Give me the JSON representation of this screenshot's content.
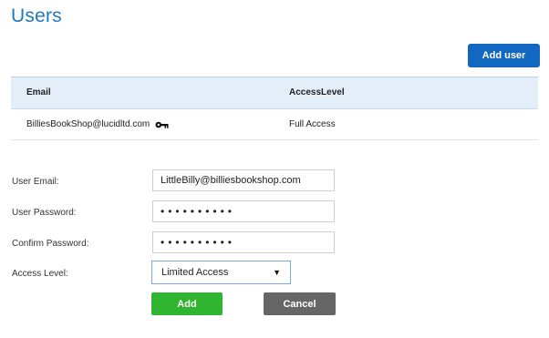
{
  "page": {
    "title": "Users",
    "add_user_label": "Add user"
  },
  "table": {
    "columns": {
      "email": "Email",
      "access": "AccessLevel"
    },
    "rows": [
      {
        "email": "BilliesBookShop@lucidltd.com",
        "access": "Full Access",
        "owner_icon": "key-icon"
      }
    ]
  },
  "form": {
    "email_label": "User Email:",
    "email_value": "LittleBilly@billiesbookshop.com",
    "password_label": "User Password:",
    "password_value": "••••••••••",
    "confirm_label": "Confirm Password:",
    "confirm_value": "••••••••••",
    "access_label": "Access Level:",
    "access_selected": "Limited Access",
    "add_label": "Add",
    "cancel_label": "Cancel"
  },
  "colors": {
    "title": "#1f79bf",
    "primary_button": "#1268c0",
    "add_button": "#2fb52f",
    "cancel_button": "#666666",
    "table_header_bg": "#e3eef9"
  }
}
